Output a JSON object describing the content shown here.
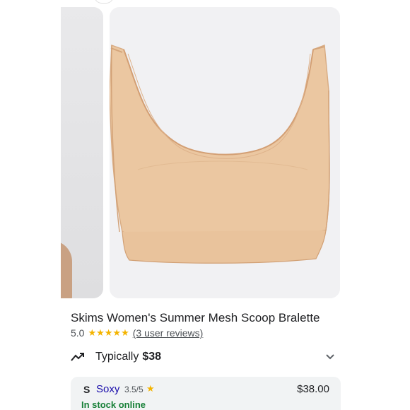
{
  "product": {
    "title": "Skims Women's Summer Mesh Scoop Bralette",
    "rating": "5.0",
    "stars": "★★★★★",
    "reviews_link": "(3 user reviews)"
  },
  "price_summary": {
    "label": "Typically",
    "price": "$38"
  },
  "offer": {
    "logo": "S",
    "seller_name": "Soxy",
    "seller_rating": "3.5/5",
    "seller_star": "★",
    "price": "$38.00",
    "stock_status": "In stock online"
  },
  "icons": {
    "trend": "trending-icon",
    "expand": "chevron-down-icon",
    "star": "star-icon"
  },
  "colors": {
    "garment": "#ebc7a1",
    "star": "#f4b400",
    "link": "#1a0dab",
    "in_stock": "#188038",
    "card_bg": "#f1f3f4"
  }
}
